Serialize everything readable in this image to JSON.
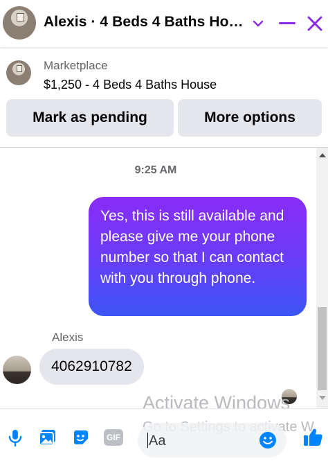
{
  "header": {
    "title": "Alexis · 4 Beds 4 Baths Ho…",
    "chevron_icon": "chevron-down-icon",
    "minimize_icon": "minimize-icon",
    "close_icon": "close-icon",
    "accent_color": "#8b2be2"
  },
  "listing": {
    "category": "Marketplace",
    "price_title": "$1,250 - 4 Beds 4 Baths House",
    "mark_pending_label": "Mark as pending",
    "more_options_label": "More options"
  },
  "conversation": {
    "timestamp": "9:25 AM",
    "outgoing_message": "Yes, this is still available and please give me your phone number so that I can contact with you through phone.",
    "sender_name": "Alexis",
    "incoming_message": "4062910782"
  },
  "watermark": {
    "title": "Activate Windows",
    "subtitle": "Go to Settings to activate W"
  },
  "composer": {
    "placeholder": "Aa",
    "icons": [
      "microphone-icon",
      "photo-icon",
      "sticker-icon",
      "gif-icon",
      "emoji-icon",
      "like-icon"
    ],
    "gif_label": "GIF",
    "icon_color": "#0084ff"
  }
}
